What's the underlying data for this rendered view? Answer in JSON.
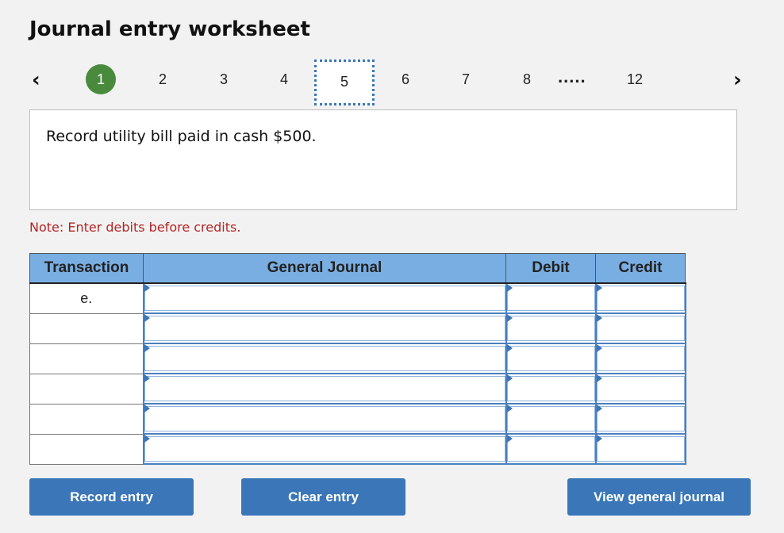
{
  "header": {
    "title": "Journal entry worksheet"
  },
  "nav": {
    "prev_icon": "‹",
    "next_icon": "›",
    "steps": [
      "1",
      "2",
      "3",
      "4",
      "5",
      "6",
      "7",
      "8"
    ],
    "ellipsis": ".....",
    "last_step": "12",
    "completed_step": "1",
    "current_step": "5"
  },
  "prompt": {
    "text": "Record utility bill paid in cash $500."
  },
  "note": "Note: Enter debits before credits.",
  "table": {
    "headers": {
      "transaction": "Transaction",
      "general_journal": "General Journal",
      "debit": "Debit",
      "credit": "Credit"
    },
    "rows": [
      {
        "transaction": "e.",
        "account": "",
        "debit": "",
        "credit": ""
      },
      {
        "transaction": "",
        "account": "",
        "debit": "",
        "credit": ""
      },
      {
        "transaction": "",
        "account": "",
        "debit": "",
        "credit": ""
      },
      {
        "transaction": "",
        "account": "",
        "debit": "",
        "credit": ""
      },
      {
        "transaction": "",
        "account": "",
        "debit": "",
        "credit": ""
      },
      {
        "transaction": "",
        "account": "",
        "debit": "",
        "credit": ""
      }
    ]
  },
  "buttons": {
    "record": "Record entry",
    "clear": "Clear entry",
    "view": "View general journal"
  },
  "colors": {
    "accent": "#3a76b8",
    "header_bg": "#79aee3",
    "done_step": "#4a8a3d",
    "note": "#b42525"
  }
}
